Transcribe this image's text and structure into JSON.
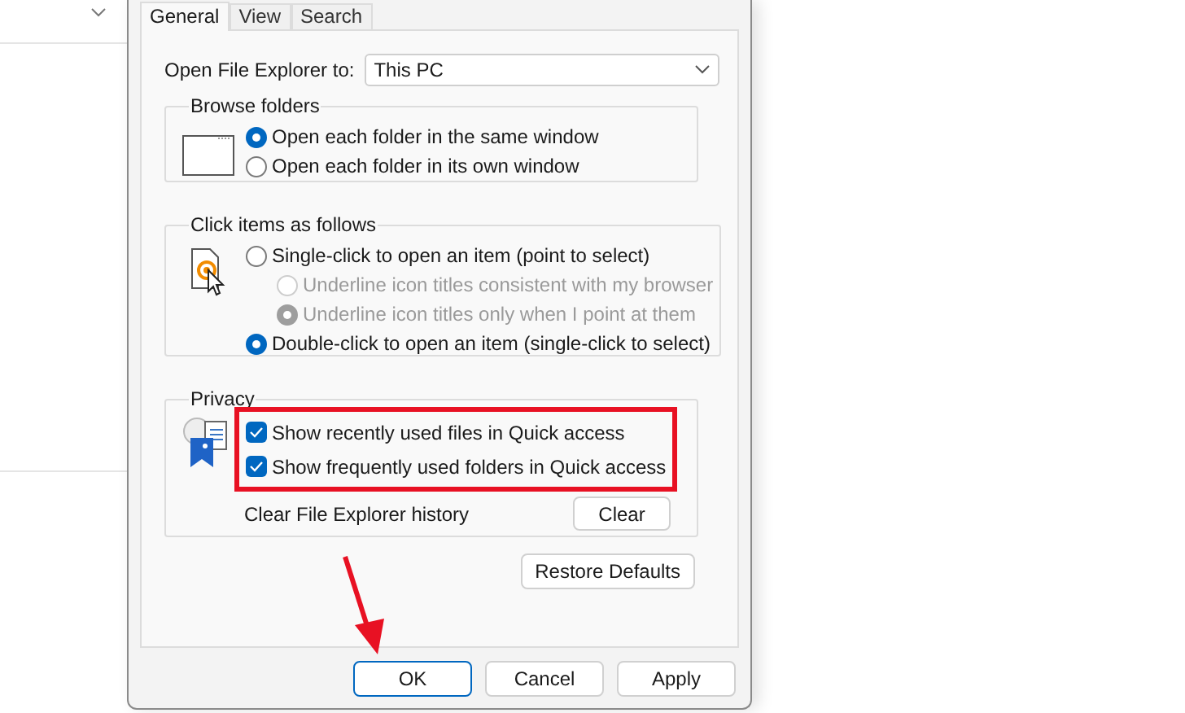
{
  "tabs": [
    {
      "label": "General",
      "selected": true
    },
    {
      "label": "View",
      "selected": false
    },
    {
      "label": "Search",
      "selected": false
    }
  ],
  "open_to": {
    "label": "Open File Explorer to:",
    "value": "This PC"
  },
  "browse_folders": {
    "title": "Browse folders",
    "options": [
      {
        "label": "Open each folder in the same window",
        "selected": true,
        "disabled": false
      },
      {
        "label": "Open each folder in its own window",
        "selected": false,
        "disabled": false
      }
    ]
  },
  "click_items": {
    "title": "Click items as follows",
    "options": [
      {
        "label": "Single-click to open an item (point to select)",
        "selected": false,
        "disabled": false,
        "children": [
          {
            "label": "Underline icon titles consistent with my browser",
            "selected": false,
            "disabled": true
          },
          {
            "label": "Underline icon titles only when I point at them",
            "selected": true,
            "disabled": true
          }
        ]
      },
      {
        "label": "Double-click to open an item (single-click to select)",
        "selected": true,
        "disabled": false
      }
    ]
  },
  "privacy": {
    "title": "Privacy",
    "highlighted": true,
    "options": [
      {
        "label": "Show recently used files in Quick access",
        "checked": true
      },
      {
        "label": "Show frequently used folders in Quick access",
        "checked": true
      }
    ],
    "clear_label": "Clear File Explorer history",
    "clear_button": "Clear"
  },
  "restore_button": "Restore Defaults",
  "buttons": [
    {
      "label": "OK",
      "default": true
    },
    {
      "label": "Cancel",
      "default": false
    },
    {
      "label": "Apply",
      "default": false
    }
  ],
  "pointer_arrow": true
}
